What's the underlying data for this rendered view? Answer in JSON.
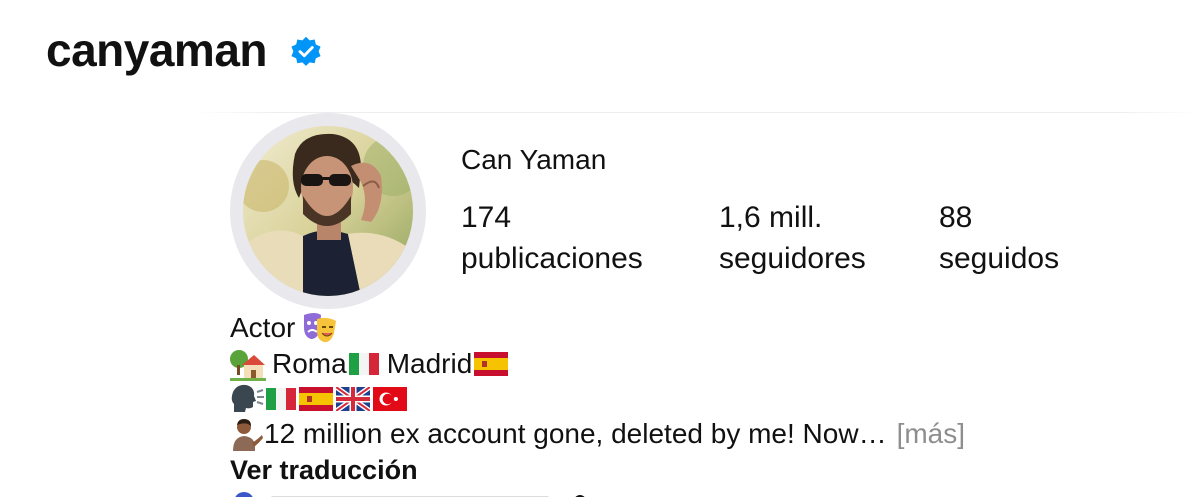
{
  "header": {
    "username": "canyaman",
    "verified_icon": "verified-badge-icon",
    "verified_color": "#0095f6"
  },
  "profile": {
    "display_name": "Can Yaman",
    "avatar_icon": "profile-photo",
    "stats": {
      "posts_count": "174",
      "posts_label": "publicaciones",
      "followers_count": "1,6 mill.",
      "followers_label": "seguidores",
      "following_count": "88",
      "following_label": "seguidos"
    }
  },
  "bio": {
    "line1": "Actor",
    "line1_emoji": "performing-arts-emoji",
    "line2_city1": "Roma",
    "line2_city2": "Madrid",
    "line2_emojis": [
      "house-with-garden-emoji",
      "flag-italy-emoji",
      "flag-spain-emoji"
    ],
    "line3_emojis": [
      "speaking-head-emoji",
      "flag-italy-emoji",
      "flag-spain-emoji",
      "flag-uk-emoji",
      "flag-turkey-emoji"
    ],
    "line4": "12 million ex account gone, deleted by me! Now…",
    "line4_emoji": "person-tipping-hand-emoji",
    "more_label": "[más]",
    "translate_label": "Ver traducción"
  }
}
